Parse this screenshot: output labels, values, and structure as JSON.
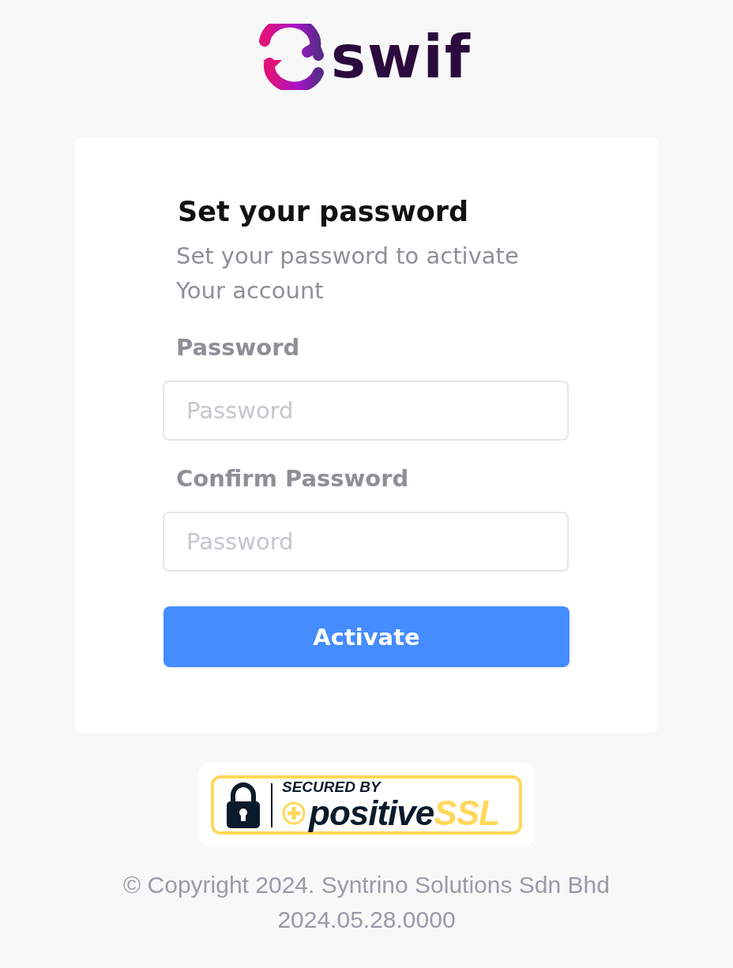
{
  "logo": {
    "text": "swif"
  },
  "form": {
    "title": "Set your password",
    "subtitle": "Set your password to activate Your account",
    "fields": [
      {
        "label": "Password",
        "placeholder": "Password"
      },
      {
        "label": "Confirm Password",
        "placeholder": "Password"
      }
    ],
    "button": "Activate"
  },
  "badge": {
    "top": "SECURED BY",
    "brand": "positive",
    "brand_accent": "SSL"
  },
  "footer": {
    "copyright": "© Copyright 2024. Syntrino Solutions Sdn Bhd",
    "version": "2024.05.28.0000"
  }
}
